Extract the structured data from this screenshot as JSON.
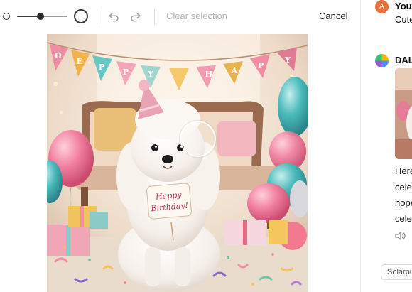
{
  "toolbar": {
    "brush_size_fraction": 0.47,
    "clear_selection_label": "Clear selection",
    "cancel_label": "Cancel"
  },
  "canvas": {
    "banner_letters": [
      "H",
      "E",
      "P",
      "P",
      "Y",
      "",
      "",
      "H",
      "A",
      "P",
      "Y",
      "Y"
    ],
    "sign_text_line1": "Happy",
    "sign_text_line2": "Birthday!"
  },
  "chat": {
    "user": {
      "avatar_letter": "A",
      "name": "You",
      "message": "Cute"
    },
    "assistant": {
      "name": "DAL",
      "reply_lines": [
        "Here",
        "celel",
        "hope",
        "celel"
      ]
    },
    "suggestion_chip": "Solarpun"
  },
  "icons": {
    "undo": "undo-icon",
    "redo": "redo-icon",
    "speaker": "speaker-icon"
  }
}
